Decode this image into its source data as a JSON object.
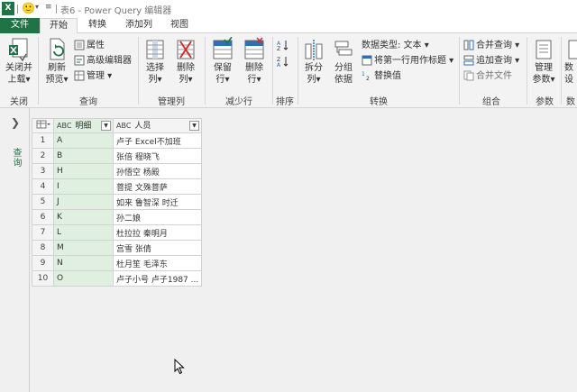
{
  "titlebar": {
    "title": "表6 - Power Query 编辑器",
    "app_icon": "X",
    "smiley_glyph": "🙂"
  },
  "tabs": {
    "file": "文件",
    "items": [
      "开始",
      "转换",
      "添加列",
      "视图"
    ]
  },
  "ribbon": {
    "close": {
      "buttons": [
        "关闭并\n上载▾"
      ],
      "label": "关闭"
    },
    "query": {
      "refresh": "刷新\n预览▾",
      "small": [
        "属性",
        "高级编辑器",
        "管理 ▾"
      ],
      "label": "查询"
    },
    "manage_cols": {
      "choose": "选择\n列▾",
      "remove": "删除\n列▾",
      "label": "管理列"
    },
    "reduce_rows": {
      "keep": "保留\n行▾",
      "remove": "删除\n行▾",
      "label": "减少行"
    },
    "sort": {
      "label": "排序"
    },
    "transform": {
      "split": "拆分\n列▾",
      "group": "分组\n依据",
      "small": [
        "数据类型: 文本 ▾",
        "将第一行用作标题 ▾",
        "替换值"
      ],
      "label": "转换"
    },
    "combine": {
      "small": [
        "合并查询 ▾",
        "追加查询 ▾",
        "合并文件"
      ],
      "label": "组合"
    },
    "params": {
      "manage": "管理\n参数▾",
      "label": "参数"
    },
    "data": {
      "partial": "数\n设",
      "label": "数"
    }
  },
  "navigator": {
    "label": "查询"
  },
  "grid": {
    "columns": [
      {
        "type": "ABC",
        "name": "明细"
      },
      {
        "type": "ABC",
        "name": "人员"
      }
    ],
    "rows": [
      {
        "n": "1",
        "a": "A",
        "b": "卢子 Excel不加班"
      },
      {
        "n": "2",
        "a": "B",
        "b": "张倍 程晓飞"
      },
      {
        "n": "3",
        "a": "H",
        "b": "孙悟空 杨殿"
      },
      {
        "n": "4",
        "a": "I",
        "b": "菩提 文殊菩萨"
      },
      {
        "n": "5",
        "a": "J",
        "b": "如来 鲁智深 时迁"
      },
      {
        "n": "6",
        "a": "K",
        "b": "孙二娘"
      },
      {
        "n": "7",
        "a": "L",
        "b": "杜拉拉 秦明月"
      },
      {
        "n": "8",
        "a": "M",
        "b": "宫雪 张倩"
      },
      {
        "n": "9",
        "a": "N",
        "b": "杜月笙 毛泽东"
      },
      {
        "n": "10",
        "a": "O",
        "b": "卢子小号 卢子1987 ..."
      }
    ]
  },
  "colors": {
    "brand": "#217346",
    "selected_col": "#dff0e1"
  }
}
